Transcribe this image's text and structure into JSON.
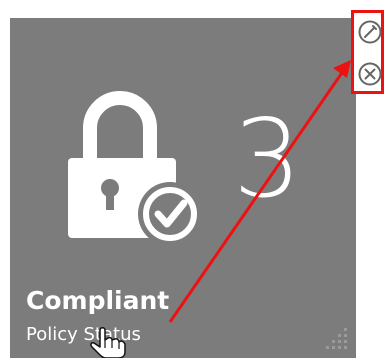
{
  "tile": {
    "count": "3",
    "title": "Compliant",
    "subtitle": "Policy Status",
    "background_color": "#7c7c7c",
    "icon": "lock-check-icon"
  },
  "actions": {
    "edit_icon": "edit-icon",
    "remove_icon": "remove-icon"
  },
  "annotation": {
    "highlight_color": "#ee1111",
    "arrow_color": "#ee1111"
  }
}
